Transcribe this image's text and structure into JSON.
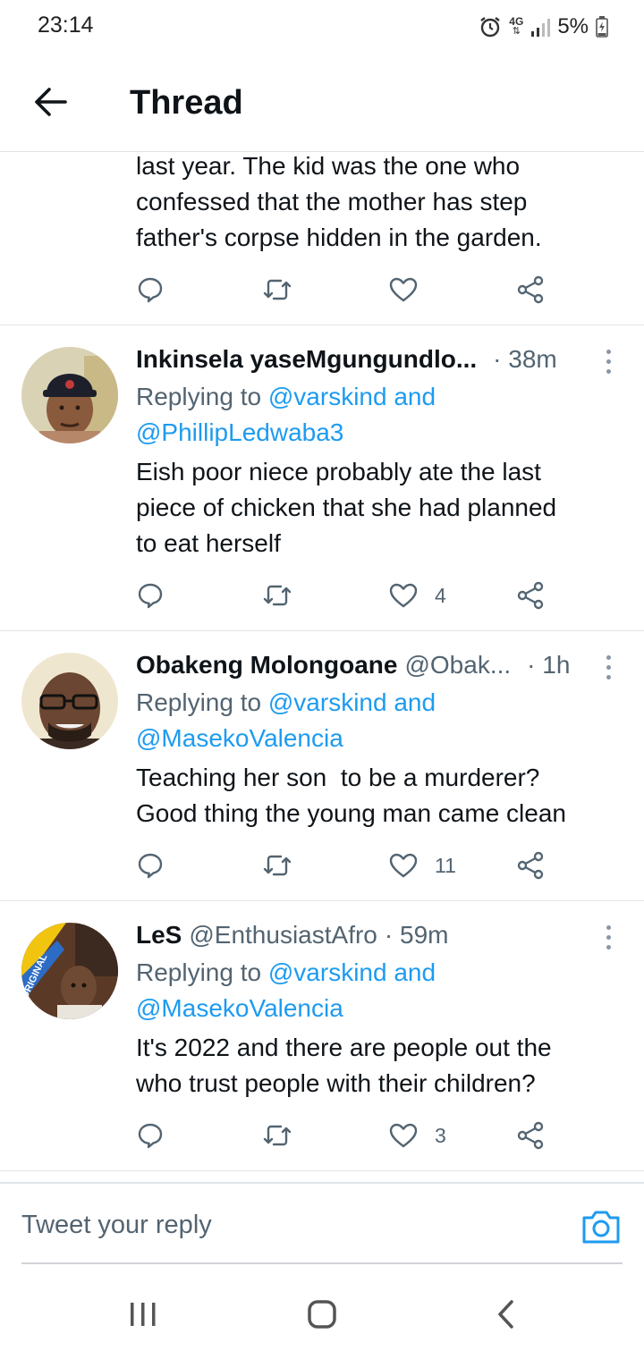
{
  "status_bar": {
    "time": "23:14",
    "network": "4G",
    "battery": "5%"
  },
  "header": {
    "title": "Thread"
  },
  "top_tweet": {
    "text": "last year. The kid was the one who\nconfessed that the mother has step\nfather's corpse hidden in the garden.",
    "like_count": ""
  },
  "replies": [
    {
      "name": "Inkinsela yaseMgungundlo...",
      "handle": "",
      "time": "· 38m",
      "replying_prefix": "Replying to",
      "mentions_line1": "@varskind and",
      "mentions_line2": "@PhillipLedwaba3",
      "text": "Eish poor niece probably ate the last\npiece of chicken that she had planned\nto eat herself",
      "like_count": "4"
    },
    {
      "name": "Obakeng Molongoane",
      "handle": "@Obak...",
      "time": "· 1h",
      "replying_prefix": "Replying to",
      "mentions_line1": "@varskind and",
      "mentions_line2": "@MasekoValencia",
      "text": "Teaching her son  to be a murderer?\nGood thing the young man came clean",
      "like_count": "11"
    },
    {
      "name": "LeS",
      "handle": "@EnthusiastAfro",
      "time": "· 59m",
      "replying_prefix": "Replying to",
      "mentions_line1": "@varskind and",
      "mentions_line2": "@MasekoValencia",
      "text": "It's 2022 and there are people out the\nwho trust people with their children?",
      "like_count": "3"
    }
  ],
  "avatar_text": {
    "les": "ORIGINAL"
  },
  "compose": {
    "placeholder": "Tweet your reply"
  },
  "colors": {
    "accent": "#1d9bf0",
    "text_primary": "#0f1419",
    "text_secondary": "#536471",
    "divider": "#e1e4e8"
  },
  "icons": {
    "back": "arrow-left-icon",
    "reply": "speech-bubble-icon",
    "retweet": "retweet-icon",
    "like": "heart-icon",
    "share": "share-icon",
    "more": "vertical-dots-icon",
    "camera": "camera-icon",
    "alarm": "alarm-icon",
    "signal": "signal-bars-icon",
    "battery": "battery-charging-icon"
  }
}
